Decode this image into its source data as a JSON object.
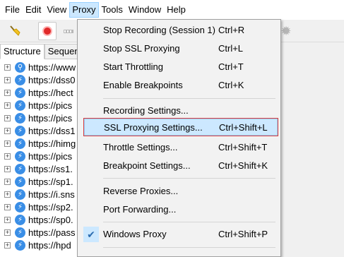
{
  "menubar": {
    "items": [
      "File",
      "Edit",
      "View",
      "Proxy",
      "Tools",
      "Window",
      "Help"
    ]
  },
  "tabs": [
    "Structure",
    "Sequence"
  ],
  "tree": {
    "rows": [
      "https://www",
      "https://dss0",
      "https://hect",
      "https://pics",
      "https://pics",
      "https://dss1",
      "https://himg",
      "https://pics",
      "https://ss1.",
      "https://sp1.",
      "https://i.sns",
      "https://sp2.",
      "https://sp0.",
      "https://pass",
      "https://hpd"
    ]
  },
  "proxy_menu": {
    "items": [
      {
        "label": "Stop Recording (Session 1)",
        "shortcut": "Ctrl+R"
      },
      {
        "label": "Stop SSL Proxying",
        "shortcut": "Ctrl+L"
      },
      {
        "label": "Start Throttling",
        "shortcut": "Ctrl+T"
      },
      {
        "label": "Enable Breakpoints",
        "shortcut": "Ctrl+K"
      },
      {
        "label": "Recording Settings...",
        "shortcut": ""
      },
      {
        "label": "SSL Proxying Settings...",
        "shortcut": "Ctrl+Shift+L"
      },
      {
        "label": "Throttle Settings...",
        "shortcut": "Ctrl+Shift+T"
      },
      {
        "label": "Breakpoint Settings...",
        "shortcut": "Ctrl+Shift+K"
      },
      {
        "label": "Reverse Proxies...",
        "shortcut": ""
      },
      {
        "label": "Port Forwarding...",
        "shortcut": ""
      },
      {
        "label": "Windows Proxy",
        "shortcut": "Ctrl+Shift+P"
      }
    ]
  },
  "icons": {
    "broom": "broom-icon",
    "record": "record-icon",
    "throttle": "throttle-icon",
    "gear": "gear-icon",
    "checkmark": "checkmark-icon"
  },
  "colors": {
    "highlight": "#cce8ff",
    "highlight_border": "#d93a3a",
    "record_red": "#e12a2a",
    "globe_blue": "#3a8ee6"
  }
}
